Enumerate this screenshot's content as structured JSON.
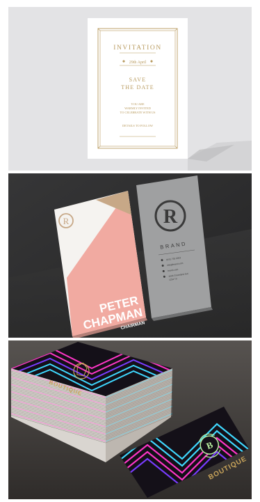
{
  "invitation": {
    "title": "INVITATION",
    "date": "29th April",
    "save_line1": "SAVE",
    "save_line2": "THE DATE",
    "body_line1": "YOU ARE",
    "body_line2": "WARMLY INVITED",
    "body_line3": "TO CELEBRATE WITH US",
    "details": "DETAILS TO FOLLOW",
    "gold_color": "#b89a5e"
  },
  "business_card": {
    "monogram": "R",
    "brand": "BRAND",
    "first_name": "PETER",
    "last_name": "CHAPMAN",
    "role": "CHAIRMAN",
    "pink_color": "#f1aaa1",
    "tan_color": "#c7a887",
    "grey_color": "#9fa0a1",
    "contact_lines": [
      "0191 735 9053",
      "info@brand.com",
      "brand.com",
      "1604 Greenland Ave",
      "1234 TX"
    ]
  },
  "boutique": {
    "label": "BOUTIQUE",
    "monogram": "B",
    "neon_pink": "#ff36c8",
    "neon_cyan": "#3fd8ff",
    "gold": "#c8a45a"
  }
}
